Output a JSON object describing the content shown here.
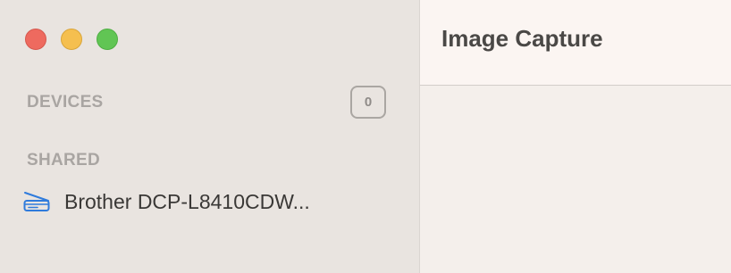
{
  "window": {
    "title": "Image Capture"
  },
  "sidebar": {
    "devices": {
      "header": "DEVICES",
      "count": "0"
    },
    "shared": {
      "header": "SHARED",
      "items": [
        {
          "label": "Brother DCP-L8410CDW...",
          "icon": "scanner-icon"
        }
      ]
    }
  },
  "colors": {
    "accent_icon": "#2f7bdc",
    "sidebar_bg": "#e9e4e0",
    "main_bg": "#f4efeb"
  }
}
